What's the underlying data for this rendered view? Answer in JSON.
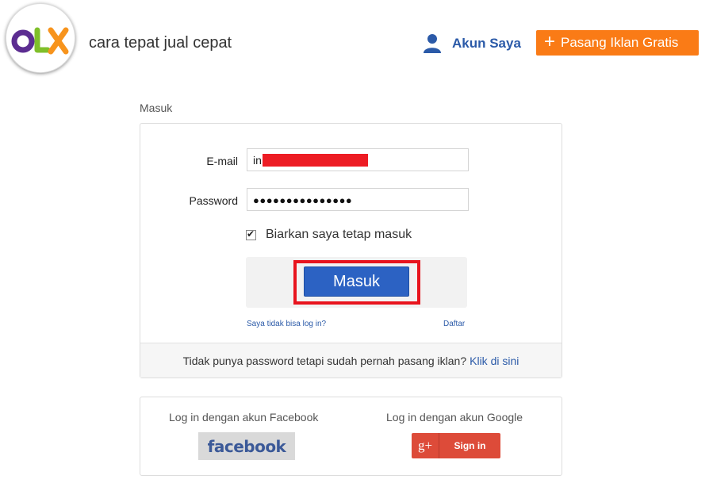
{
  "header": {
    "logo_text": "OLX",
    "tagline": "cara tepat jual cepat",
    "account_label": "Akun Saya",
    "post_ad_label": "Pasang Iklan Gratis",
    "post_ad_icon": "plus-icon"
  },
  "section_title": "Masuk",
  "login": {
    "email_label": "E-mail",
    "email_value": "in",
    "password_label": "Password",
    "password_value": "●●●●●●●●●●●●●●●",
    "remember_label": "Biarkan saya tetap masuk",
    "remember_checked": true,
    "submit_label": "Masuk",
    "forgot_label": "Saya tidak bisa log in?",
    "register_label": "Daftar"
  },
  "footer_note": {
    "text": "Tidak punya password tetapi sudah pernah pasang iklan?",
    "link": "Klik di sini"
  },
  "social": {
    "facebook_label": "Log in dengan akun Facebook",
    "facebook_button": "facebook",
    "google_label": "Log in dengan akun Google",
    "google_icon_text": "g+",
    "google_button": "Sign in"
  },
  "colors": {
    "brand_orange": "#fa7b16",
    "link_blue": "#2b5aa8",
    "button_blue": "#2c62c3",
    "highlight_red": "#e8141e",
    "google_red": "#dd4b39",
    "facebook_blue": "#3b5998"
  }
}
